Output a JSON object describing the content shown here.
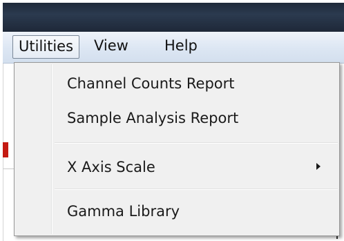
{
  "menubar": {
    "items": [
      {
        "label": "Utilities",
        "open": true
      },
      {
        "label": "View"
      },
      {
        "label": "Help"
      }
    ]
  },
  "dropdown": {
    "items": [
      {
        "label": "Channel Counts Report"
      },
      {
        "label": "Sample Analysis Report"
      },
      {
        "label": "X Axis Scale",
        "has_submenu": true
      },
      {
        "label": "Gamma Library"
      }
    ]
  },
  "colors": {
    "titlebar": "#1f2a3a",
    "menubar": "#dce6f3",
    "menu_bg": "#f0f0f0",
    "accent_red": "#c41a12"
  },
  "icons": {
    "submenu": "chevron-right-icon"
  }
}
